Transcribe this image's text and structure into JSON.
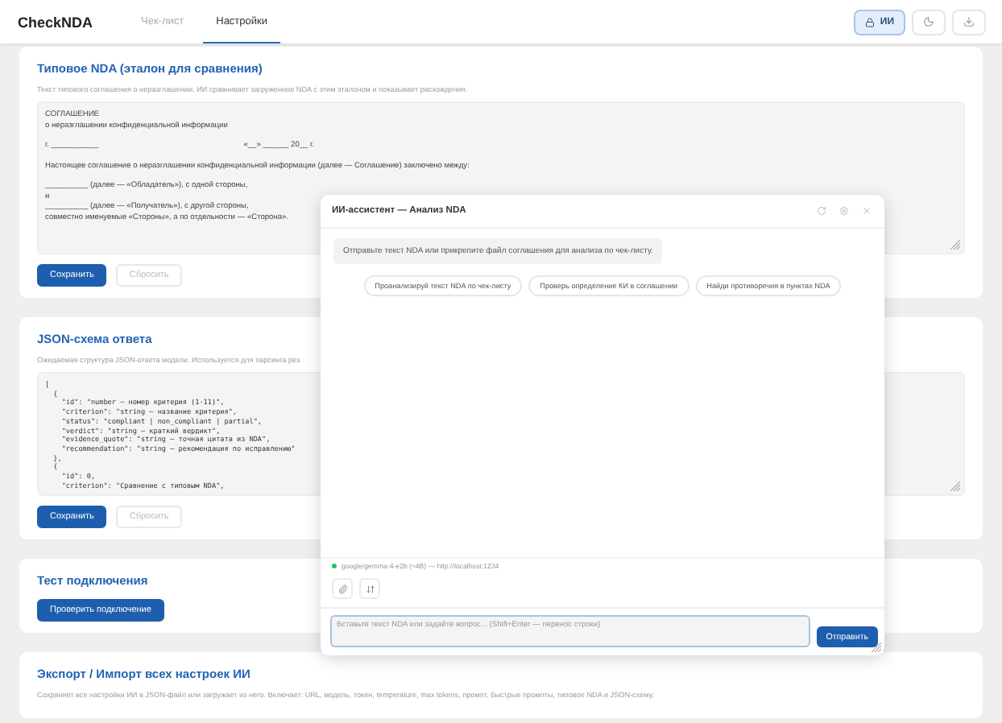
{
  "header": {
    "logo": "CheckNDA",
    "tabs": [
      {
        "label": "Чек-лист",
        "selected": false
      },
      {
        "label": "Настройки",
        "selected": true
      }
    ],
    "buttons": [
      {
        "kind": "ai",
        "label": "ИИ",
        "active": true
      },
      {
        "kind": "theme",
        "active": false
      },
      {
        "kind": "download",
        "active": false
      }
    ]
  },
  "reference_card": {
    "title": "Типовое NDA (эталон для сравнения)",
    "description": "Текст типового соглашения о неразглашении. ИИ сравнивает загруженное NDA с этим эталоном и показывает расхождения.",
    "paragraphs": [
      [
        {
          "text": "СОГЛАШЕНИЕ"
        },
        {
          "text": "о неразглашении конфиденциальной информации"
        }
      ],
      [
        {
          "text": "г. ___________",
          "aside": "«__» ______ 20__ г."
        }
      ],
      [
        {
          "text": "Настоящее соглашение о неразглашении конфиденциальной информации (далее — Соглашение) заключено между:"
        }
      ],
      [
        {
          "text": "__________ (далее — «Обладатель»), с одной стороны,"
        },
        {
          "text": "и"
        },
        {
          "text": "__________ (далее — «Получатель»), с другой стороны,"
        },
        {
          "text": "совместно именуемые «Стороны», а по отдельности — «Сторона»."
        }
      ]
    ],
    "buttons": [
      {
        "label": "Сохранить",
        "disabled": false
      },
      {
        "label": "Сбросить",
        "disabled": true
      }
    ]
  },
  "schema_card": {
    "title": "JSON-схема ответа",
    "description": "Ожидаемая структура JSON-ответа модели. Используется для парсинга рез",
    "lines": [
      "[",
      "  {",
      "    \"id\": \"number — номер критерия (1-11)\",",
      "    \"criterion\": \"string — название критерия\",",
      "    \"status\": \"compliant | non_compliant | partial\",",
      "    \"verdict\": \"string — краткий вердикт\",",
      "    \"evidence_quote\": \"string — точная цитата из NDA\",",
      "    \"recommendation\": \"string — рекомендация по исправлению\"",
      "  },",
      "  {",
      "    \"id\": 0,",
      "    \"criterion\": \"Сравнение с типовым NDA\","
    ],
    "buttons": [
      {
        "label": "Сохранить",
        "disabled": false
      },
      {
        "label": "Сбросить",
        "disabled": true
      }
    ]
  },
  "connection_card": {
    "title": "Тест подключения",
    "button": "Проверить подключение"
  },
  "export_card": {
    "title": "Экспорт / Импорт всех настроек ИИ",
    "description": "Сохраняет все настройки ИИ в JSON-файл или загружает из него. Включает: URL, модель, токен, temperature, max tokens, промпт, быстрые промпты, типовое NDA и JSON-схему."
  },
  "dialog": {
    "title": "ИИ-ассистент — Анализ NDA",
    "message": "Отправьте текст NDA или прикрепите файл соглашения для анализа по чек-листу.",
    "suggestions": [
      "Проанализируй текст NDA по чек-листу",
      "Проверь определение КИ в соглашении",
      "Найди противоречия в пунктах NDA"
    ],
    "status": {
      "online": true,
      "text": "google/gemma-4-e2b (≈4B) — http://localhost:1234"
    },
    "input": {
      "placeholder": "Вставьте текст NDA или задайте вопрос... (Shift+Enter — перенос строки)"
    },
    "send_button": "Отправить"
  }
}
